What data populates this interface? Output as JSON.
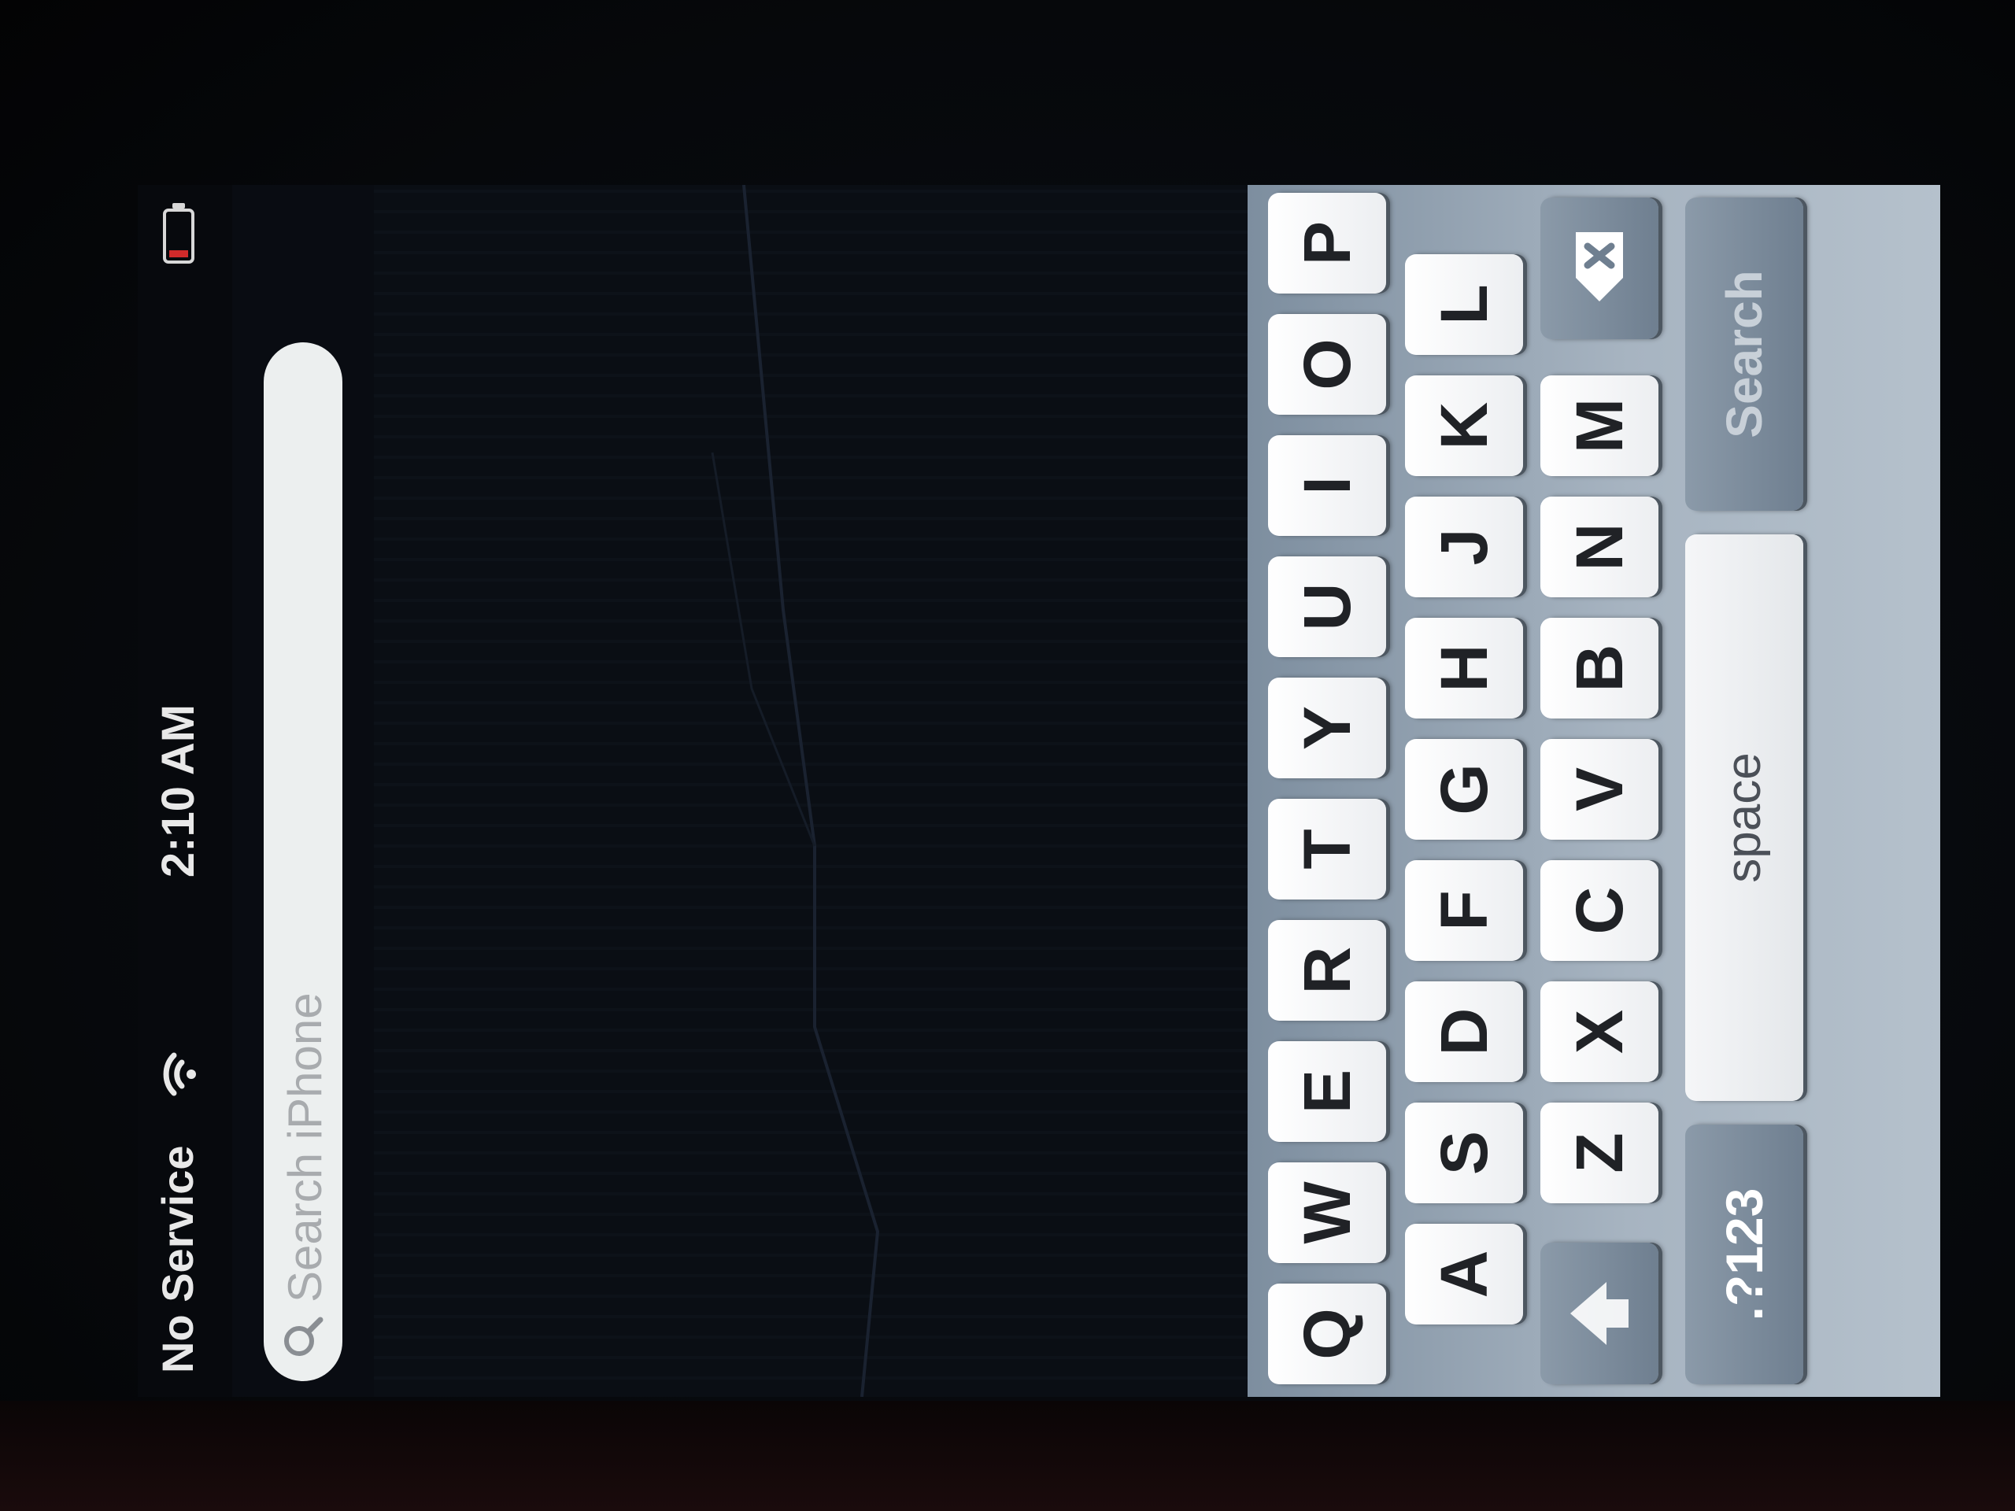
{
  "status_bar": {
    "carrier": "No Service",
    "time": "2:10 AM",
    "wifi_icon": "wifi-icon",
    "battery_icon": "battery-low-icon",
    "battery_level_color": "#d12a2a"
  },
  "search": {
    "placeholder": "Search iPhone",
    "icon": "search-icon"
  },
  "keyboard": {
    "row1": [
      "Q",
      "W",
      "E",
      "R",
      "T",
      "Y",
      "U",
      "I",
      "O",
      "P"
    ],
    "row2": [
      "A",
      "S",
      "D",
      "F",
      "G",
      "H",
      "J",
      "K",
      "L"
    ],
    "row3": [
      "Z",
      "X",
      "C",
      "V",
      "B",
      "N",
      "M"
    ],
    "shift_icon": "shift-arrow-icon",
    "delete_icon": "delete-backspace-icon",
    "numbers_label": ".?123",
    "space_label": "space",
    "search_label": "Search"
  },
  "colors": {
    "keyboard_bg": "#93a3b3",
    "key_bg": "#ffffff",
    "function_key_bg": "#7b8b9b"
  }
}
